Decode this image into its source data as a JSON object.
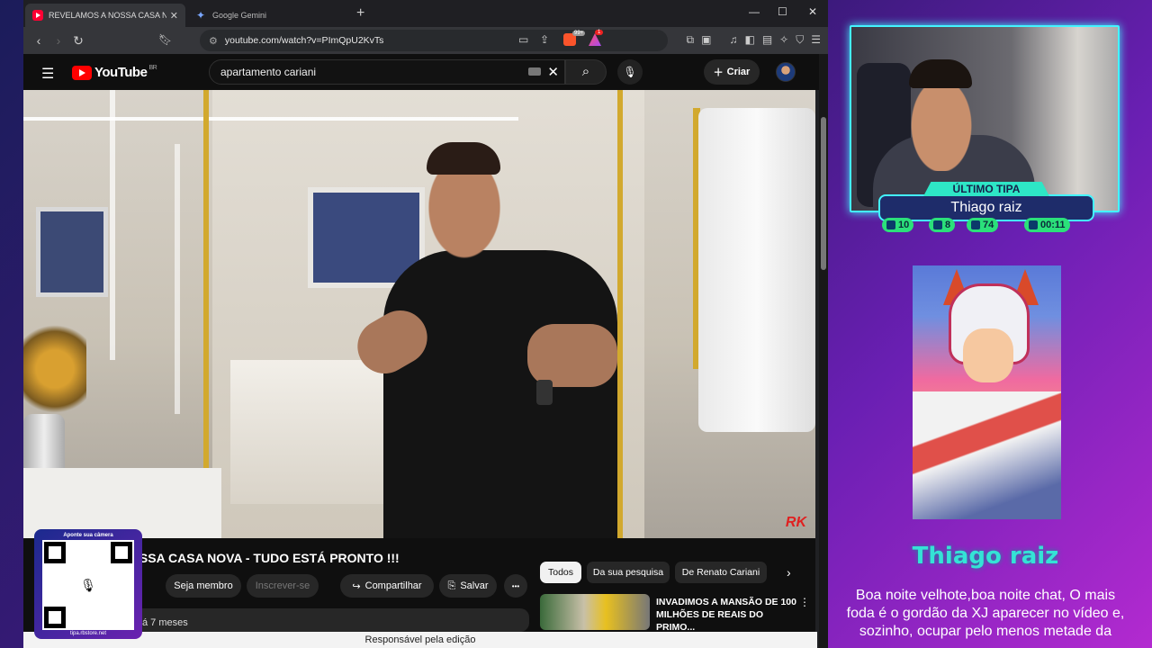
{
  "browser": {
    "tabs": [
      {
        "title": "REVELAMOS A NOSSA CASA NOVA - T",
        "icon": "youtube-icon",
        "active": true
      },
      {
        "title": "Google Gemini",
        "icon": "gemini-icon",
        "active": false
      }
    ],
    "new_tab": "+",
    "window_controls": {
      "minimize": "—",
      "maximize": "☐",
      "close": "✕"
    },
    "url": "youtube.com/watch?v=PImQpU2KvTs",
    "extension_badges": {
      "brave_shields": "99+",
      "rewards": "1"
    }
  },
  "youtube": {
    "logo_text": "YouTube",
    "country_code": "BR",
    "search_value": "apartamento cariani",
    "create_label": "Criar",
    "video_title": "OSSA CASA NOVA - TUDO ESTÁ PRONTO !!!",
    "watermark": "RK",
    "actions": {
      "member": "Seja membro",
      "subscribe": "Inscrever-se",
      "share": "Compartilhar",
      "save": "Salvar",
      "more": "•••"
    },
    "chips": [
      "Todos",
      "Da sua pesquisa",
      "De Renato Cariani"
    ],
    "age": "á 7 meses",
    "recommended": {
      "title": "INVADIMOS A MANSÃO DE 100 MILHÕES DE REAIS DO PRIMO..."
    }
  },
  "status_bar": "Responsável pela edição",
  "qr_panel": {
    "top_text": "Aponte sua câmera",
    "bottom_text": "tipa.rbstore.net"
  },
  "overlay": {
    "last_tip_label": "ÚLTIMO TIPA",
    "last_tip_name": "Thiago raiz",
    "stats": {
      "twitch": "10",
      "youtube": "8",
      "tipa": "74",
      "timer": "00:11"
    },
    "donor_name": "Thiago raiz",
    "message": "Boa noite velhote,boa noite chat, O mais foda é o gordão da XJ aparecer no vídeo e, sozinho, ocupar pelo menos metade da"
  },
  "colors": {
    "accent_cyan": "#43f4ff",
    "yt_red": "#ff0000",
    "stat_green": "#2be07a"
  }
}
